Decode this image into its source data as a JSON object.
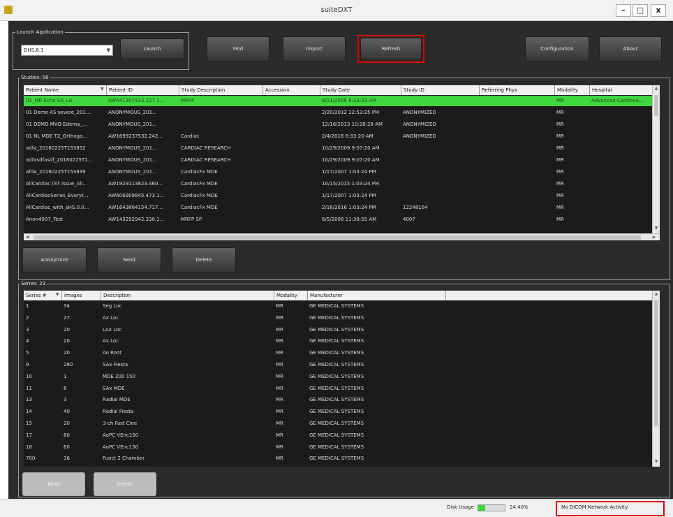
{
  "window": {
    "title": "suiteDXT",
    "min_label": "–",
    "max_label": "□",
    "close_label": "x"
  },
  "launch": {
    "group_label": "Launch Application",
    "app_value": "DHS.8.1",
    "launch_label": "Launch"
  },
  "toolbar": {
    "find_label": "Find",
    "import_label": "Import",
    "refresh_label": "Refresh",
    "configuration_label": "Configuration",
    "about_label": "About"
  },
  "studies": {
    "group_label": "Studies: 56",
    "columns": [
      "Patient Name",
      "Patient ID",
      "Study Description",
      "Accession",
      "Study Date",
      "Study ID",
      "Referring Phys",
      "Modality",
      "Hospital"
    ],
    "rows": [
      [
        "01_MR Echo SA_LA",
        "AW641307433.227.1...",
        "MRFP",
        "",
        "8/21/2008 8:23:23 AM",
        "",
        "",
        "MR",
        "Advanced Cardiova..."
      ],
      [
        "01 Demo AS severe_201...",
        "ANONYMOUS_201...",
        "",
        "",
        "2/20/2012 12:53:35 PM",
        "ANONYMIZED",
        "",
        "MR",
        ""
      ],
      [
        "01 DEMO MVO Edema_...",
        "ANONYMOUS_201...",
        "",
        "",
        "12/16/2013 10:28:28 AM",
        "ANONYMIZED",
        "",
        "MR",
        ""
      ],
      [
        "01 NL MDE T2_Orthogo...",
        "AW1699237532.242...",
        "Cardiac",
        "",
        "2/4/2016 8:33:20 AM",
        "ANONYMIZED",
        "",
        "MR",
        ""
      ],
      [
        "adfa_20160225T153852",
        "ANONYMOUS_201...",
        "CARDIAC RESEARCH",
        "",
        "10/29/2009 9:07:20 AM",
        "",
        "",
        "MR",
        ""
      ],
      [
        "adfasdfasdf_20160225T1...",
        "ANONYMOUS_201...",
        "CARDIAC RESEARCH",
        "",
        "10/29/2009 9:07:20 AM",
        "",
        "",
        "MR",
        ""
      ],
      [
        "afda_20160225T153839",
        "ANONYMOUS_201...",
        "CardiacFx MDE",
        "",
        "1/17/2007 1:03:24 PM",
        "",
        "",
        "MR",
        ""
      ],
      [
        "AllCardiac (ST Issue_All...",
        "AW1929113823.460...",
        "CardiacFx MDE",
        "",
        "10/15/2015 1:03:24 PM",
        "",
        "",
        "MR",
        ""
      ],
      [
        "AllCardiacSeries_Everyt...",
        "AW606909845.473.1...",
        "CardiacFx MDE",
        "",
        "1/17/2007 1:03:24 PM",
        "",
        "",
        "MR",
        ""
      ],
      [
        "AllCardiac_with_sHS.0.0...",
        "AW1643864154.717...",
        "CardiacFx MDE",
        "",
        "2/16/2016 1:03:24 PM",
        "12248164",
        "",
        "MR",
        ""
      ],
      [
        "Anon4007_Test",
        "AW143292942.330.1...",
        "MRFP SP",
        "",
        "6/5/2008 11:38:55 AM",
        "4007",
        "",
        "MR",
        ""
      ]
    ],
    "anonymize_label": "Anonymize",
    "send_label": "Send",
    "delete_label": "Delete"
  },
  "series": {
    "group_label": "Series: 23",
    "columns": [
      "Series #",
      "Images",
      "Description",
      "Modality",
      "Manufacturer"
    ],
    "rows": [
      [
        "1",
        "34",
        "Seg Loc",
        "MR",
        "GE MEDICAL SYSTEMS"
      ],
      [
        "2",
        "27",
        "Ax Loc",
        "MR",
        "GE MEDICAL SYSTEMS"
      ],
      [
        "3",
        "20",
        "LAx Loc",
        "MR",
        "GE MEDICAL SYSTEMS"
      ],
      [
        "4",
        "20",
        "Ax Loc",
        "MR",
        "GE MEDICAL SYSTEMS"
      ],
      [
        "5",
        "20",
        "Ao Root",
        "MR",
        "GE MEDICAL SYSTEMS"
      ],
      [
        "9",
        "280",
        "SAx Fiesta",
        "MR",
        "GE MEDICAL SYSTEMS"
      ],
      [
        "10",
        "1",
        "MDE 200 150",
        "MR",
        "GE MEDICAL SYSTEMS"
      ],
      [
        "11",
        "6",
        "SAx MDE",
        "MR",
        "GE MEDICAL SYSTEMS"
      ],
      [
        "13",
        "3",
        "Radial MDE",
        "MR",
        "GE MEDICAL SYSTEMS"
      ],
      [
        "14",
        "40",
        "Radial Fiesta",
        "MR",
        "GE MEDICAL SYSTEMS"
      ],
      [
        "15",
        "20",
        "3-ch Fast Cine",
        "MR",
        "GE MEDICAL SYSTEMS"
      ],
      [
        "17",
        "60",
        "AoPC VEnc150",
        "MR",
        "GE MEDICAL SYSTEMS"
      ],
      [
        "18",
        "60",
        "AoPC VEnc150",
        "MR",
        "GE MEDICAL SYSTEMS"
      ],
      [
        "700",
        "16",
        "Funct 2 Chamber",
        "MR",
        "GE MEDICAL SYSTEMS"
      ]
    ],
    "keep_label": "Keep",
    "delete_label": "Delete"
  },
  "status": {
    "disk_usage_label": "Disk Usage",
    "disk_usage_value": "24.40%",
    "disk_usage_fraction": 0.244,
    "network_status": "No DICOM Network Activity"
  },
  "colors": {
    "selection": "#3fd63f",
    "highlight": "#e00000",
    "panel": "#2b2b2b"
  }
}
